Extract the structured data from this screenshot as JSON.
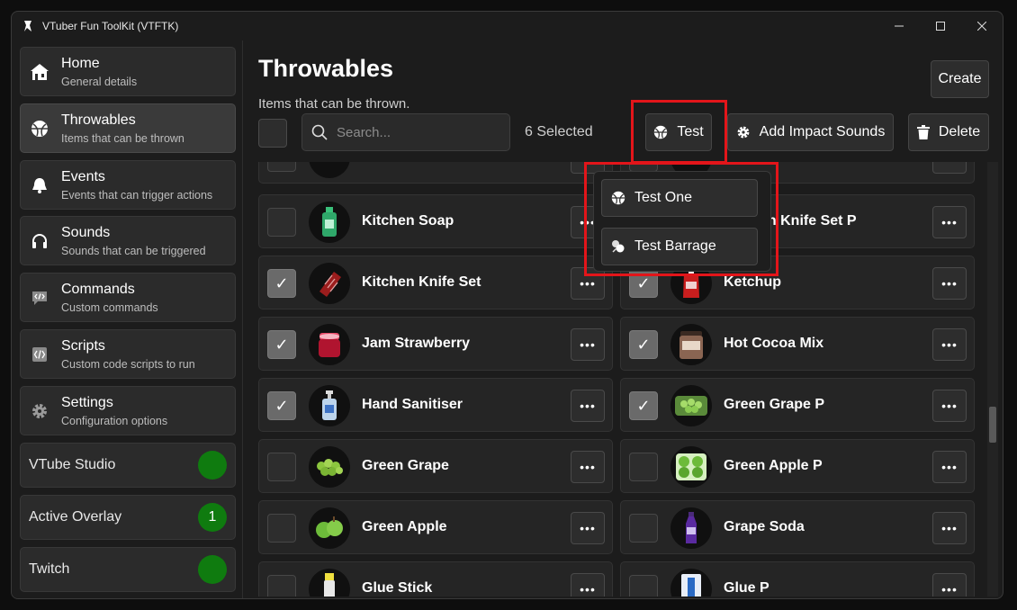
{
  "window": {
    "title": "VTuber Fun ToolKit (VTFTK)"
  },
  "sidebar": {
    "items": [
      {
        "title": "Home",
        "subtitle": "General details",
        "icon": "home-icon"
      },
      {
        "title": "Throwables",
        "subtitle": "Items that can be thrown",
        "icon": "ball-icon",
        "active": true
      },
      {
        "title": "Events",
        "subtitle": "Events that can trigger actions",
        "icon": "bell-icon"
      },
      {
        "title": "Sounds",
        "subtitle": "Sounds that can be triggered",
        "icon": "headphones-icon"
      },
      {
        "title": "Commands",
        "subtitle": "Custom commands",
        "icon": "code-chat-icon"
      },
      {
        "title": "Scripts",
        "subtitle": "Custom code scripts to run",
        "icon": "code-file-icon"
      },
      {
        "title": "Settings",
        "subtitle": "Configuration options",
        "icon": "gear-icon"
      }
    ],
    "status": [
      {
        "label": "VTube Studio",
        "badge": ""
      },
      {
        "label": "Active Overlay",
        "badge": "1"
      },
      {
        "label": "Twitch",
        "badge": ""
      }
    ]
  },
  "page": {
    "title": "Throwables",
    "subtitle": "Items that can be thrown.",
    "create_label": "Create"
  },
  "toolbar": {
    "search_placeholder": "Search...",
    "selected_text": "6 Selected",
    "test_label": "Test",
    "impact_label": "Add Impact Sounds",
    "delete_label": "Delete"
  },
  "dropdown": {
    "test_one": "Test One",
    "test_barrage": "Test Barrage"
  },
  "items": [
    {
      "name": "Kitchen Soap",
      "checked": false
    },
    {
      "name": "Kitchen Knife Set P",
      "checked": false
    },
    {
      "name": "Kitchen Knife Set",
      "checked": true
    },
    {
      "name": "Ketchup",
      "checked": true
    },
    {
      "name": "Jam Strawberry",
      "checked": true
    },
    {
      "name": "Hot Cocoa Mix",
      "checked": true
    },
    {
      "name": "Hand Sanitiser",
      "checked": true
    },
    {
      "name": "Green Grape P",
      "checked": true
    },
    {
      "name": "Green Grape",
      "checked": false
    },
    {
      "name": "Green Apple P",
      "checked": false
    },
    {
      "name": "Green Apple",
      "checked": false
    },
    {
      "name": "Grape Soda",
      "checked": false
    },
    {
      "name": "Glue Stick",
      "checked": false
    },
    {
      "name": "Glue P",
      "checked": false
    }
  ],
  "colors": {
    "accent_red": "#e3151a",
    "status_green": "#0f7b0f"
  }
}
